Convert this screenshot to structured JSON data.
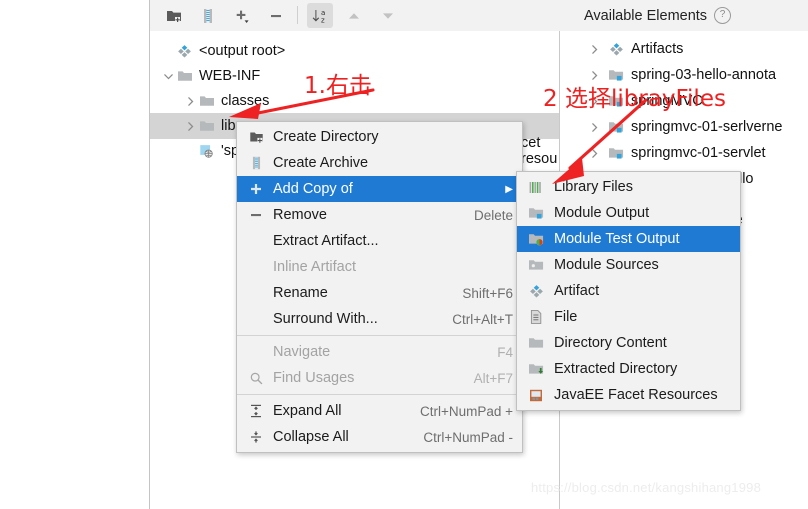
{
  "toolbar": {
    "buttons": [
      {
        "name": "create-directory-icon",
        "title": "Create Directory",
        "active": false
      },
      {
        "name": "create-archive-icon",
        "title": "Create Archive",
        "active": false
      },
      {
        "name": "add-icon",
        "title": "Add",
        "active": false
      },
      {
        "name": "remove-icon",
        "title": "Remove",
        "active": false
      },
      {
        "name": "sort-alphabetically-icon",
        "title": "Sort Alphabetically",
        "active": true
      },
      {
        "name": "move-up-icon",
        "title": "Move Up",
        "active": false
      },
      {
        "name": "move-down-icon",
        "title": "Move Down",
        "active": false
      }
    ]
  },
  "available_panel": {
    "title": "Available Elements",
    "help_glyph": "?",
    "items": [
      {
        "label": "Artifacts",
        "icon": "artifact-icon",
        "arrow": "collapsed"
      },
      {
        "label": "spring-03-hello-annota",
        "icon": "module-output-icon",
        "arrow": "collapsed"
      },
      {
        "label": "springMVC",
        "icon": "module-output-icon",
        "arrow": "collapsed"
      },
      {
        "label": "springmvc-01-serlverne",
        "icon": "module-output-icon",
        "arrow": "collapsed"
      },
      {
        "label": "springmvc-01-servlet",
        "icon": "module-output-icon",
        "arrow": "collapsed"
      },
      {
        "label": "springmvc-02-hello",
        "icon": "module-sources-icon",
        "arrow": "collapsed"
      },
      {
        "label": "-controlle",
        "icon": "none",
        "arrow": "none"
      }
    ]
  },
  "output_tree": {
    "items": [
      {
        "label": "<output root>",
        "icon": "artifact-icon",
        "arrow": "none",
        "indent": 0,
        "selected": false
      },
      {
        "label": "WEB-INF",
        "icon": "folder-icon",
        "arrow": "expanded",
        "indent": 0,
        "selected": false
      },
      {
        "label": "classes",
        "icon": "folder-icon",
        "arrow": "collapsed",
        "indent": 1,
        "selected": false
      },
      {
        "label": "lib",
        "icon": "folder-icon",
        "arrow": "collapsed",
        "indent": 1,
        "selected": true
      },
      {
        "label": "'spri",
        "icon": "facet-resources-icon",
        "arrow": "none",
        "indent": 1,
        "selected": false
      }
    ],
    "clipped_text": "cet resou"
  },
  "context_menu": {
    "items": [
      {
        "label": "Create Directory",
        "accel": "",
        "icon": "create-directory-icon",
        "state": "normal",
        "submenu": false
      },
      {
        "label": "Create Archive",
        "accel": "",
        "icon": "create-archive-icon",
        "state": "normal",
        "submenu": false
      },
      {
        "label": "Add Copy of",
        "accel": "",
        "icon": "plus-icon",
        "state": "highlight",
        "submenu": true
      },
      {
        "label": "Remove",
        "accel": "Delete",
        "icon": "minus-icon",
        "state": "normal",
        "submenu": false
      },
      {
        "label": "Extract Artifact...",
        "accel": "",
        "icon": "none",
        "state": "normal",
        "submenu": false
      },
      {
        "label": "Inline Artifact",
        "accel": "",
        "icon": "none",
        "state": "disabled",
        "submenu": false
      },
      {
        "label": "Rename",
        "accel": "Shift+F6",
        "icon": "none",
        "state": "normal",
        "submenu": false
      },
      {
        "label": "Surround With...",
        "accel": "Ctrl+Alt+T",
        "icon": "none",
        "state": "normal",
        "submenu": false
      },
      {
        "separator": true
      },
      {
        "label": "Navigate",
        "accel": "F4",
        "icon": "none",
        "state": "disabled",
        "submenu": false
      },
      {
        "label": "Find Usages",
        "accel": "Alt+F7",
        "icon": "search-icon",
        "state": "disabled",
        "submenu": false
      },
      {
        "separator": true
      },
      {
        "label": "Expand All",
        "accel": "Ctrl+NumPad +",
        "icon": "expand-all-icon",
        "state": "normal",
        "submenu": false
      },
      {
        "label": "Collapse All",
        "accel": "Ctrl+NumPad -",
        "icon": "collapse-all-icon",
        "state": "normal",
        "submenu": false
      }
    ],
    "submenu_arrow_glyph": "▶"
  },
  "submenu": {
    "items": [
      {
        "label": "Library Files",
        "icon": "library-files-icon",
        "state": "normal"
      },
      {
        "label": "Module Output",
        "icon": "module-output-icon",
        "state": "normal"
      },
      {
        "label": "Module Test Output",
        "icon": "module-test-output-icon",
        "state": "highlight"
      },
      {
        "label": "Module Sources",
        "icon": "module-sources-icon",
        "state": "normal"
      },
      {
        "label": "Artifact",
        "icon": "artifact-icon",
        "state": "normal"
      },
      {
        "label": "File",
        "icon": "file-icon",
        "state": "normal"
      },
      {
        "label": "Directory Content",
        "icon": "directory-content-icon",
        "state": "normal"
      },
      {
        "label": "Extracted Directory",
        "icon": "extracted-directory-icon",
        "state": "normal"
      },
      {
        "label": "JavaEE Facet Resources",
        "icon": "javaee-facet-icon",
        "state": "normal"
      }
    ]
  },
  "annotations": {
    "step1": "1.右击",
    "step2": "2 选择librayFiles",
    "color": "#ef2020"
  },
  "watermark": {
    "text": "https://blog.csdn.net/kangshihang1998"
  },
  "colors": {
    "highlight": "#1f7ad4",
    "toolbar_bg": "#f2f2f2",
    "menu_bg": "#f2f2f2",
    "selection_row": "#d4d4d4",
    "annotation_red": "#ef2020"
  }
}
